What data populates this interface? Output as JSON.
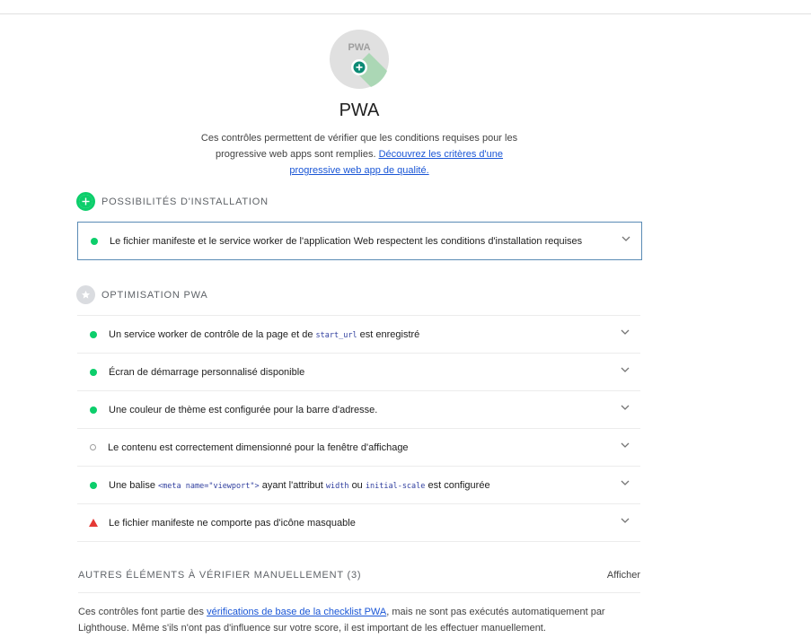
{
  "header": {
    "badge_text": "PWA",
    "title": "PWA",
    "desc_text": "Ces contrôles permettent de vérifier que les conditions requises pour les progressive web apps sont remplies.",
    "desc_link": "Découvrez les critères d'une progressive web app de qualité."
  },
  "install": {
    "title": "POSSIBILITÉS D'INSTALLATION",
    "audit": "Le fichier manifeste et le service worker de l'application Web respectent les conditions d'installation requises"
  },
  "optim": {
    "title": "OPTIMISATION PWA",
    "a1_pre": "Un service worker de contrôle de la page et de",
    "a1_code": "start_url",
    "a1_post": "est enregistré",
    "a2": "Écran de démarrage personnalisé disponible",
    "a3": "Une couleur de thème est configurée pour la barre d'adresse.",
    "a4": "Le contenu est correctement dimensionné pour la fenêtre d'affichage",
    "a5_pre": "Une balise",
    "a5_code1": "<meta name=\"viewport\">",
    "a5_mid": "ayant l'attribut",
    "a5_code2": "width",
    "a5_or": "ou",
    "a5_code3": "initial-scale",
    "a5_post": "est configurée",
    "a6": "Le fichier manifeste ne comporte pas d'icône masquable"
  },
  "manual": {
    "title": "AUTRES ÉLÉMENTS À VÉRIFIER MANUELLEMENT (3)",
    "button": "Afficher",
    "desc_pre": "Ces contrôles font partie des",
    "desc_link": "vérifications de base de la checklist PWA",
    "desc_post": ", mais ne sont pas exécutés automatiquement par Lighthouse. Même s'ils n'ont pas d'influence sur votre score, il est important de les effectuer manuellement."
  },
  "colors": {
    "pass": "#0cce6b",
    "fail": "#e53935",
    "link": "#1a56d6"
  }
}
